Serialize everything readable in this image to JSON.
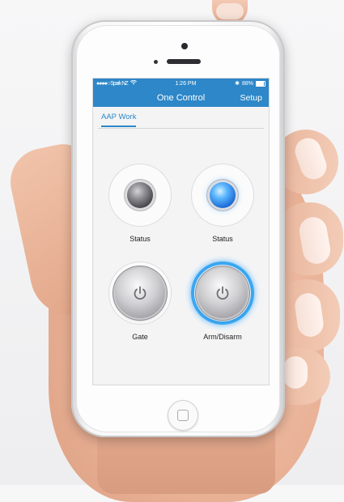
{
  "statusbar": {
    "carrier": "●●●●○ Spark NZ",
    "time": "1:26 PM",
    "battery": "88%"
  },
  "navbar": {
    "title": "One Control",
    "setup_label": "Setup"
  },
  "tabs": [
    {
      "label": "AAP Work",
      "active": true
    }
  ],
  "tiles": [
    {
      "label": "Status",
      "kind": "indicator",
      "state": "off",
      "color": "#6e6e73"
    },
    {
      "label": "Status",
      "kind": "indicator",
      "state": "on",
      "color": "#2a86f0"
    },
    {
      "label": "Gate",
      "kind": "button",
      "state": "idle"
    },
    {
      "label": "Arm/Disarm",
      "kind": "button",
      "state": "active",
      "color": "#3aa6f0"
    }
  ],
  "colors": {
    "accent": "#2d87c8"
  }
}
